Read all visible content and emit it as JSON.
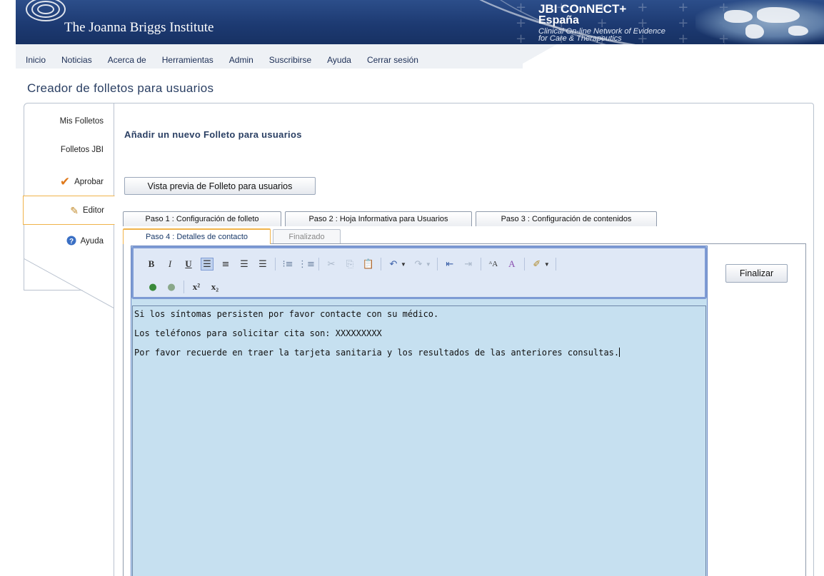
{
  "header": {
    "org_name": "The Joanna Briggs Institute",
    "jbi_title": "JBI COnNECT+",
    "jbi_country": "España",
    "jbi_subtitle_line1": "Clinical On-line Network of Evidence",
    "jbi_subtitle_line2": "for Care & Therapeutics",
    "brand_color": "#1d3a72"
  },
  "nav": {
    "items": [
      "Inicio",
      "Noticias",
      "Acerca de",
      "Herramientas",
      "Admin",
      "Suscribirse",
      "Ayuda",
      "Cerrar sesión"
    ]
  },
  "page": {
    "title": "Creador de folletos para usuarios"
  },
  "sidebar": {
    "items": [
      {
        "label": "Mis Folletos",
        "icon": ""
      },
      {
        "label": "Folletos JBI",
        "icon": ""
      },
      {
        "label": "Aprobar",
        "icon": "checkmark-icon"
      },
      {
        "label": "Editor",
        "icon": "pencil-icon",
        "active": true
      },
      {
        "label": "Ayuda",
        "icon": "help-icon"
      }
    ]
  },
  "main": {
    "section_title": "Añadir un nuevo Folleto para usuarios",
    "preview_button": "Vista previa de Folleto para usuarios",
    "tabs_row1": [
      "Paso 1 : Configuración de folleto",
      "Paso 2 : Hoja Informativa para Usuarios",
      "Paso 3 : Configuración de contenidos"
    ],
    "tabs_row2": [
      "Paso 4 : Detalles de contacto",
      "Finalizado"
    ],
    "active_tab": "Paso 4 : Detalles de contacto",
    "finish_button": "Finalizar"
  },
  "editor": {
    "lines": [
      "Si los síntomas persisten por favor contacte con su médico.",
      "Los teléfonos para solicitar cita son: XXXXXXXXX",
      "Por favor recuerde en traer la tarjeta sanitaria y los resultados de las anteriores consultas."
    ],
    "toolbar_row1": [
      "bold-icon",
      "italic-icon",
      "underline-icon",
      "align-left-icon",
      "align-center-icon",
      "align-right-icon",
      "align-justify-icon",
      "numbered-list-icon",
      "bulleted-list-icon",
      "cut-icon",
      "copy-icon",
      "paste-icon",
      "undo-icon",
      "redo-icon",
      "outdent-icon",
      "indent-icon",
      "font-size-icon",
      "font-color-icon",
      "highlight-icon"
    ],
    "toolbar_row2": [
      "link-icon",
      "unlink-icon",
      "superscript-icon",
      "subscript-icon"
    ],
    "background_color": "#c6e0f0"
  }
}
